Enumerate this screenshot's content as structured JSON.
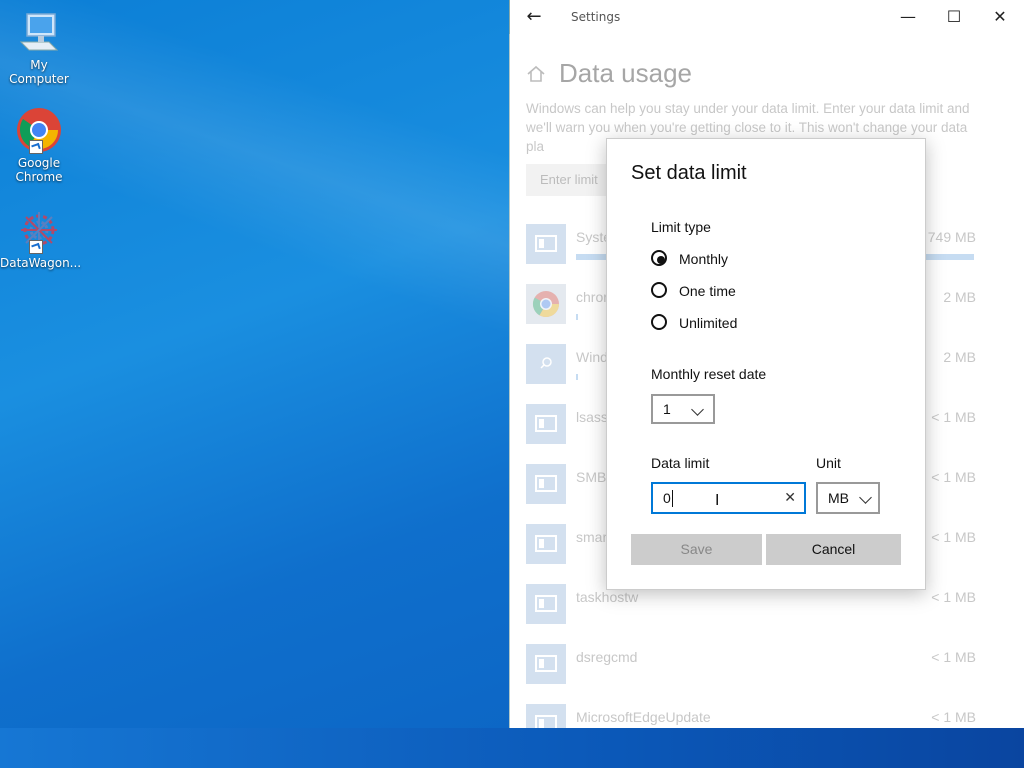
{
  "desktop": {
    "icons": [
      {
        "label": "My Computer",
        "icon": "computer-icon"
      },
      {
        "label_line1": "Google",
        "label_line2": "Chrome",
        "icon": "chrome-icon"
      },
      {
        "label": "DataWagon...",
        "icon": "datawagon-icon"
      }
    ]
  },
  "settings_window": {
    "title": "Settings",
    "back_icon": "←",
    "minimize_icon": "—",
    "maximize_icon": "☐",
    "close_icon": "✕",
    "page_title": "Data usage",
    "description": "Windows can help you stay under your data limit. Enter your data limit and we'll warn you when you're getting close to it. This won't change your data pla",
    "enter_limit_button": "Enter limit",
    "apps": [
      {
        "name": "Syste",
        "size": "749 MB",
        "usage_fraction": 1.0
      },
      {
        "name": "chron",
        "size": "2 MB",
        "usage_fraction": 0.005
      },
      {
        "name": "Wind",
        "size": "2 MB",
        "usage_fraction": 0.005
      },
      {
        "name": "lsass",
        "size": "< 1 MB"
      },
      {
        "name": "SMB",
        "size": "< 1 MB"
      },
      {
        "name": "smar",
        "size": "< 1 MB"
      },
      {
        "name": "taskhostw",
        "size": "< 1 MB"
      },
      {
        "name": "dsregcmd",
        "size": "< 1 MB"
      },
      {
        "name": "MicrosoftEdgeUpdate",
        "size": "< 1 MB"
      }
    ]
  },
  "dialog": {
    "title": "Set data limit",
    "limit_type_label": "Limit type",
    "options": [
      {
        "label": "Monthly",
        "selected": true
      },
      {
        "label": "One time",
        "selected": false
      },
      {
        "label": "Unlimited",
        "selected": false
      }
    ],
    "reset_date_label": "Monthly reset date",
    "reset_date_value": "1",
    "data_limit_label": "Data limit",
    "data_limit_value": "0",
    "unit_label": "Unit",
    "unit_value": "MB",
    "save_label": "Save",
    "cancel_label": "Cancel"
  }
}
